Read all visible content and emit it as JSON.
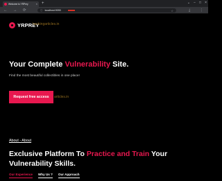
{
  "browser": {
    "tab_title": "Welcome to YRPrey",
    "tab_close": "×",
    "new_tab": "+",
    "window_controls": [
      "⌄",
      "−",
      "□",
      "×"
    ],
    "nav": {
      "back": "←",
      "forward": "→",
      "reload": "⟳"
    },
    "url": "localhost:9090",
    "url_icon": "ⓘ",
    "star": "☆",
    "right_tools": [
      "⤓",
      "⋮"
    ]
  },
  "site": {
    "logo_text": "YRPREY",
    "watermark": "hackingarticles.in",
    "watermark_button": "articles.in",
    "hero": {
      "title_prefix": "Your Complete ",
      "title_accent": "Vulnerability",
      "title_suffix": " Site.",
      "subtitle": "Find the most beautiful collectibles in one place!",
      "cta_label": "Request free access"
    },
    "about": {
      "label": "About - About",
      "title_prefix": "Exclusive Platform To ",
      "title_accent": "Practice and Train",
      "title_suffix": " Your Vulnerability Skills."
    },
    "tabs": [
      "Our Experience",
      "Why Us ?",
      "Our Approach"
    ]
  },
  "colors": {
    "accent": "#e8184f",
    "background": "#000000",
    "chrome": "#35363a"
  }
}
